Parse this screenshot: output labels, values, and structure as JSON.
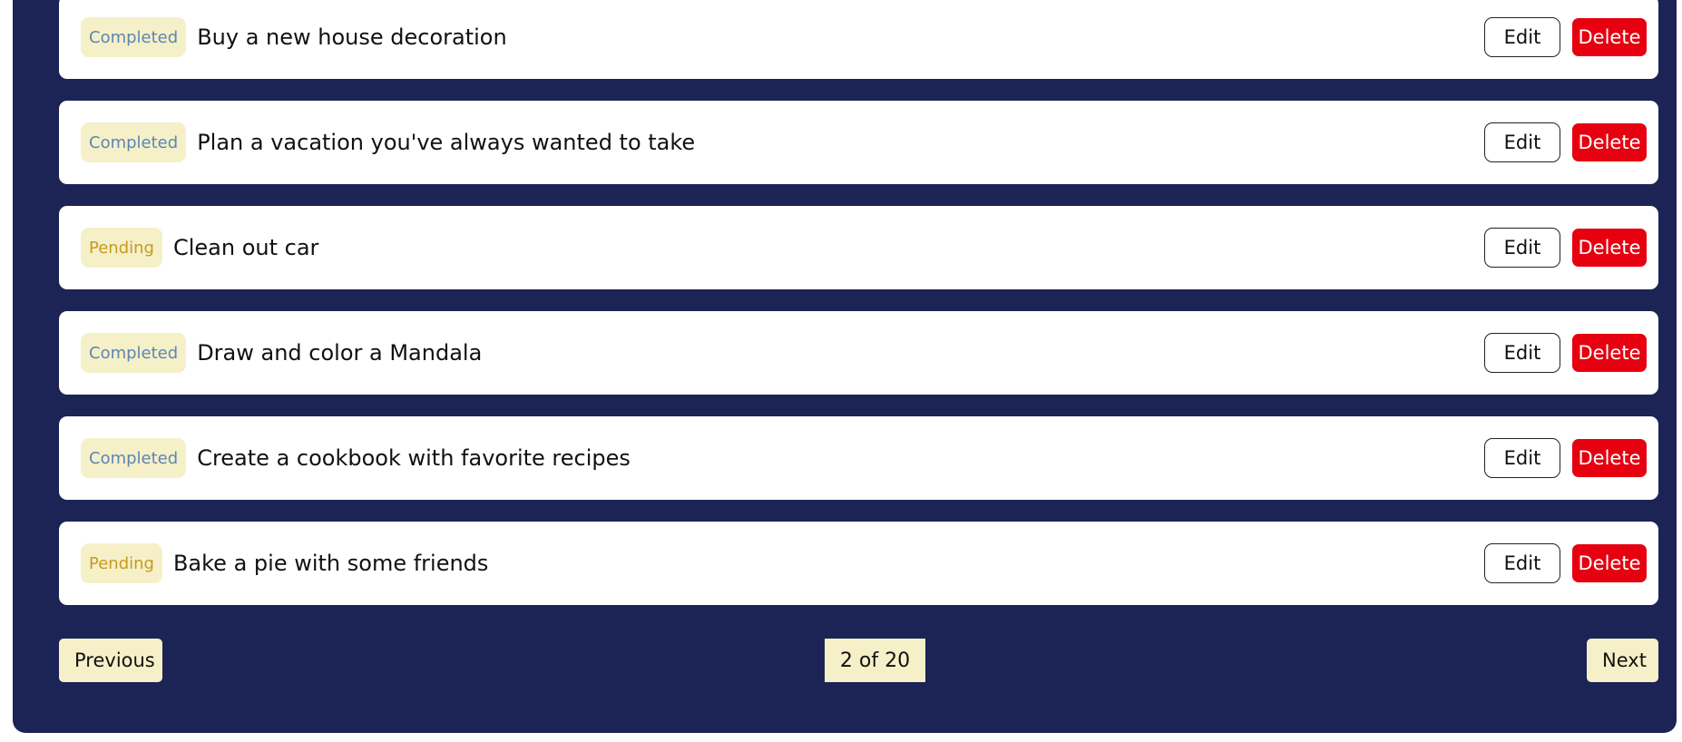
{
  "todos": [
    {
      "status": "Completed",
      "status_key": "completed",
      "text": "Buy a new house decoration",
      "edit_label": "Edit",
      "delete_label": "Delete"
    },
    {
      "status": "Completed",
      "status_key": "completed",
      "text": "Plan a vacation you've always wanted to take",
      "edit_label": "Edit",
      "delete_label": "Delete"
    },
    {
      "status": "Pending",
      "status_key": "pending",
      "text": "Clean out car",
      "edit_label": "Edit",
      "delete_label": "Delete"
    },
    {
      "status": "Completed",
      "status_key": "completed",
      "text": "Draw and color a Mandala",
      "edit_label": "Edit",
      "delete_label": "Delete"
    },
    {
      "status": "Completed",
      "status_key": "completed",
      "text": "Create a cookbook with favorite recipes",
      "edit_label": "Edit",
      "delete_label": "Delete"
    },
    {
      "status": "Pending",
      "status_key": "pending",
      "text": "Bake a pie with some friends",
      "edit_label": "Edit",
      "delete_label": "Delete"
    }
  ],
  "pagination": {
    "previous_label": "Previous",
    "page_indicator": "2 of 20",
    "next_label": "Next"
  },
  "colors": {
    "panel_background": "#1b2455",
    "badge_background": "#f5f0c8",
    "completed_text": "#5d86b3",
    "pending_text": "#c89a1c",
    "delete_button": "#e60010"
  }
}
